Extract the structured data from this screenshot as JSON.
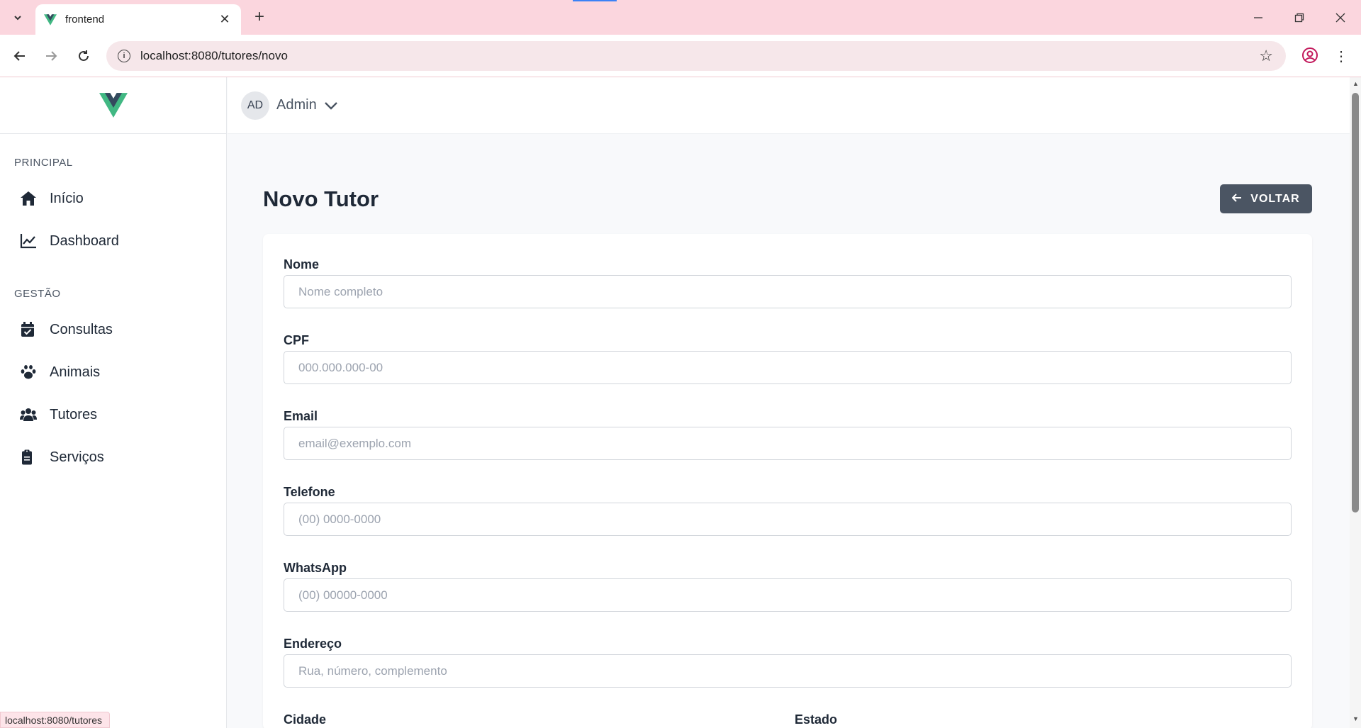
{
  "browser": {
    "tab_title": "frontend",
    "url": "localhost:8080/tutores/novo",
    "status_url": "localhost:8080/tutores"
  },
  "header": {
    "avatar_initials": "AD",
    "username": "Admin"
  },
  "sidebar": {
    "sections": [
      {
        "title": "PRINCIPAL",
        "items": [
          {
            "label": "Início",
            "icon": "home-icon"
          },
          {
            "label": "Dashboard",
            "icon": "chart-line-icon"
          }
        ]
      },
      {
        "title": "GESTÃO",
        "items": [
          {
            "label": "Consultas",
            "icon": "calendar-check-icon"
          },
          {
            "label": "Animais",
            "icon": "paw-icon"
          },
          {
            "label": "Tutores",
            "icon": "users-icon"
          },
          {
            "label": "Serviços",
            "icon": "clipboard-icon"
          }
        ]
      }
    ]
  },
  "main": {
    "title": "Novo Tutor",
    "back_label": "VOLTAR",
    "form": {
      "nome": {
        "label": "Nome",
        "placeholder": "Nome completo",
        "value": ""
      },
      "cpf": {
        "label": "CPF",
        "placeholder": "000.000.000-00",
        "value": ""
      },
      "email": {
        "label": "Email",
        "placeholder": "email@exemplo.com",
        "value": ""
      },
      "telefone": {
        "label": "Telefone",
        "placeholder": "(00) 0000-0000",
        "value": ""
      },
      "whatsapp": {
        "label": "WhatsApp",
        "placeholder": "(00) 00000-0000",
        "value": ""
      },
      "endereco": {
        "label": "Endereço",
        "placeholder": "Rua, número, complemento",
        "value": ""
      },
      "cidade": {
        "label": "Cidade"
      },
      "estado": {
        "label": "Estado"
      }
    }
  },
  "colors": {
    "tabbar_bg": "#fbd6de",
    "vue_green": "#41b883",
    "vue_dark": "#35495e",
    "button_bg": "#4b5563"
  }
}
